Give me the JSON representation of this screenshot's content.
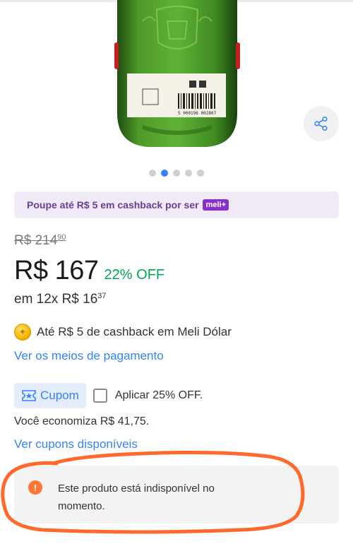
{
  "carousel": {
    "total": 5,
    "active_index": 1
  },
  "banner": {
    "cashback_text": "Poupe até R$ 5 em cashback por ser",
    "meli_badge": "meli+"
  },
  "pricing": {
    "original_price_main": "R$ 214",
    "original_price_cents": "90",
    "current_price": "R$ 167",
    "discount": "22% OFF",
    "installments_main": "em 12x R$ 16",
    "installments_cents": "37"
  },
  "cashback": {
    "text": "Até R$ 5 de cashback em Meli Dólar"
  },
  "payment": {
    "link_label": "Ver os meios de pagamento"
  },
  "coupon": {
    "tag_label": "Cupom",
    "apply_label": "Aplicar 25% OFF.",
    "checked": false,
    "savings_text": "Você economiza R$ 41,75.",
    "view_link": "Ver cupons disponíveis"
  },
  "availability": {
    "message": "Este produto está indisponível no momento."
  },
  "colors": {
    "accent_blue": "#3483fa",
    "discount_green": "#00a650",
    "meli_purple": "#8b2fcb",
    "alert_orange": "#ff7733",
    "annotation_orange": "#ff6a2c"
  },
  "label_lines": [
    "5 000196 002807"
  ]
}
